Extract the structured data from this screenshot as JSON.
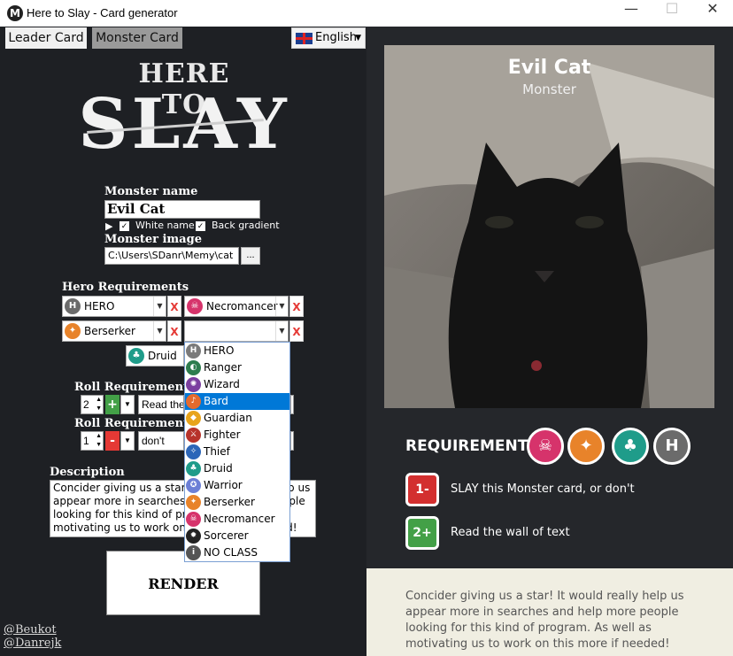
{
  "window": {
    "title": "Here to Slay - Card generator",
    "logo": "M",
    "minimize": "—",
    "maximize": "☐",
    "close": "✕"
  },
  "tabs": [
    {
      "label": "Leader Card"
    },
    {
      "label": "Monster Card"
    }
  ],
  "language": {
    "label": "English"
  },
  "logo": {
    "line1": "HERE TO",
    "line2": "SLAY"
  },
  "form": {
    "monster_name_label": "Monster name",
    "monster_name_value": "Evil Cat",
    "white_name_label": "White name",
    "back_gradient_label": "Back gradient",
    "monster_image_label": "Monster image",
    "monster_image_path": "C:\\Users\\SDanr\\Memy\\cat",
    "browse_label": "...",
    "hero_req_label": "Hero Requirements",
    "hero_slots": [
      {
        "value": "HERO",
        "icon": "H"
      },
      {
        "value": "Necromancer",
        "icon": "☠"
      },
      {
        "value": "Berserker",
        "icon": "✦"
      },
      {
        "value": "",
        "icon": ""
      },
      {
        "value": "Druid",
        "icon": "♣"
      }
    ],
    "remove_label": "X",
    "roll_req_label_1": "Roll Requirements -",
    "roll_req_label_2": "Roll Requirements -",
    "roll1": {
      "value": "2",
      "sign": "+",
      "text": "Read the"
    },
    "roll2": {
      "value": "1",
      "sign": "-",
      "text": "don't"
    },
    "description_label": "Description",
    "description_text": "Concider giving us a star! It would really help us appear more in searches and help more people looking for this kind of program. As well as motivating us to work on this more if needed!",
    "render_label": "RENDER",
    "credits": [
      "@Beukot",
      "@Danrejk"
    ]
  },
  "dropdown": {
    "items": [
      {
        "label": "HERO",
        "icon": "H",
        "color": "#7a7a7a"
      },
      {
        "label": "Ranger",
        "icon": "◐",
        "color": "#2e7d4f"
      },
      {
        "label": "Wizard",
        "icon": "✺",
        "color": "#7b3fa0"
      },
      {
        "label": "Bard",
        "icon": "♪",
        "color": "#e46a2e"
      },
      {
        "label": "Guardian",
        "icon": "◆",
        "color": "#e8a41c"
      },
      {
        "label": "Fighter",
        "icon": "⚔",
        "color": "#b7332b"
      },
      {
        "label": "Thief",
        "icon": "✧",
        "color": "#2c66b8"
      },
      {
        "label": "Druid",
        "icon": "♣",
        "color": "#1f9c8a"
      },
      {
        "label": "Warrior",
        "icon": "✪",
        "color": "#6c7fd6"
      },
      {
        "label": "Berserker",
        "icon": "✦",
        "color": "#e8832a"
      },
      {
        "label": "Necromancer",
        "icon": "☠",
        "color": "#d6336b"
      },
      {
        "label": "Sorcerer",
        "icon": "✹",
        "color": "#222222"
      },
      {
        "label": "NO CLASS",
        "icon": "i",
        "color": "#555555"
      }
    ],
    "highlighted": "Bard"
  },
  "card": {
    "name": "Evil Cat",
    "type": "Monster",
    "requirement_label": "REQUIREMENT:",
    "req_icons": [
      {
        "icon": "☠",
        "color": "#d6336b"
      },
      {
        "icon": "✦",
        "color": "#e8832a"
      },
      {
        "icon": "♣",
        "color": "#1f9c8a"
      },
      {
        "icon": "H",
        "color": "#6b6b6b"
      }
    ],
    "roll_rows": [
      {
        "badge": "1-",
        "color": "#d32f2f",
        "text": "SLAY this Monster card, or don't"
      },
      {
        "badge": "2+",
        "color": "#43a047",
        "text": "Read the wall of text"
      }
    ],
    "description": "Concider giving us a star! It would really help us appear more in searches and help more people looking for this kind of program. As well as motivating us to work on this more if needed!"
  }
}
